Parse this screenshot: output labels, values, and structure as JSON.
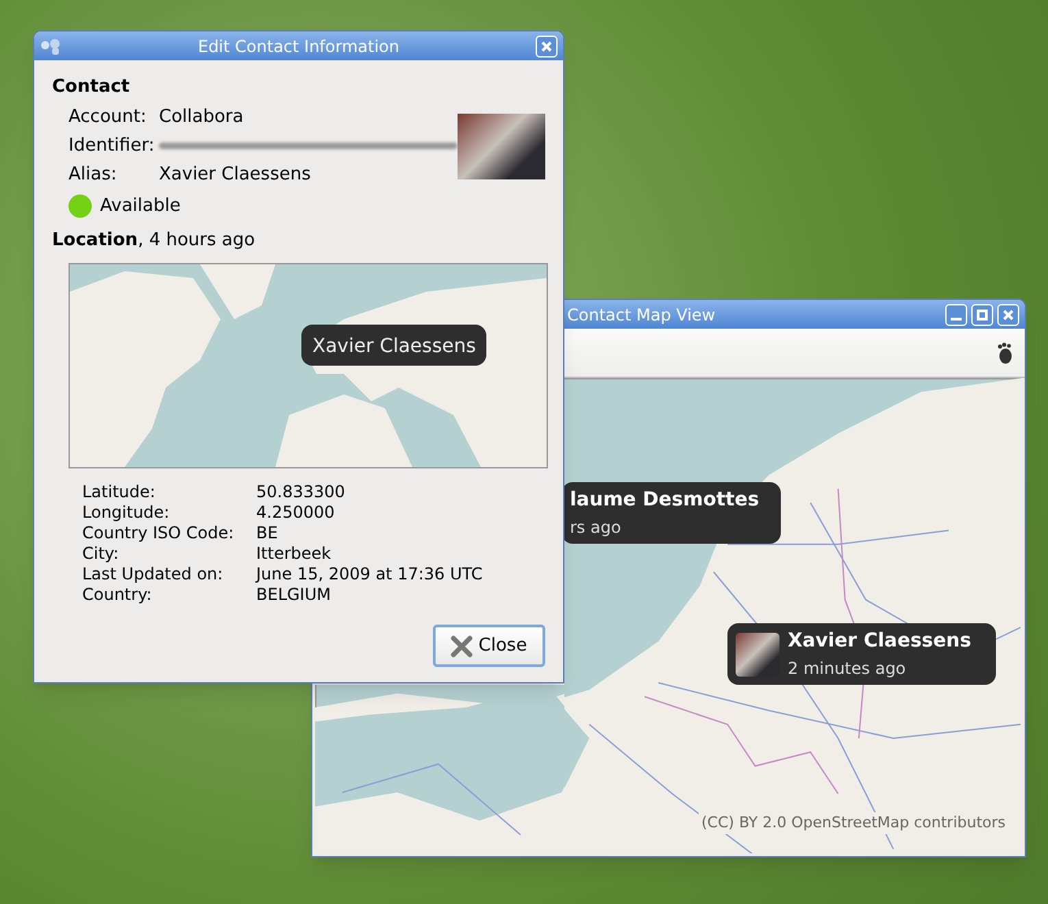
{
  "edit_window": {
    "title": "Edit Contact Information",
    "contact_heading": "Contact",
    "fields": [
      {
        "kind": "text",
        "label": "Account:",
        "value": "Collabora"
      },
      {
        "kind": "blurred",
        "label": "Identifier:"
      },
      {
        "kind": "text",
        "label": "Alias:",
        "value": "Xavier Claessens"
      }
    ],
    "presence": {
      "color": "#73d216",
      "label": "Available"
    },
    "location_heading": "**Location**, 4 hours ago",
    "map_marker": "Xavier Claessens",
    "details": [
      {
        "label": "Latitude:",
        "value": "50.833300"
      },
      {
        "label": "Longitude:",
        "value": "4.250000"
      },
      {
        "label": "Country ISO Code:",
        "value": "BE"
      },
      {
        "label": "City:",
        "value": "Itterbeek"
      },
      {
        "label": "Last Updated on:",
        "value": "June 15, 2009 at 17:36 UTC"
      },
      {
        "label": "Country:",
        "value": "BELGIUM"
      }
    ],
    "close_button": "Close"
  },
  "map_window": {
    "title": "Contact Map View",
    "markers": [
      {
        "name": "laume Desmottes",
        "time": "rs ago",
        "avatar": false
      },
      {
        "name": "Xavier Claessens",
        "time": "2 minutes ago",
        "avatar": true
      }
    ],
    "attribution": "(CC) BY 2.0 OpenStreetMap contributors"
  }
}
